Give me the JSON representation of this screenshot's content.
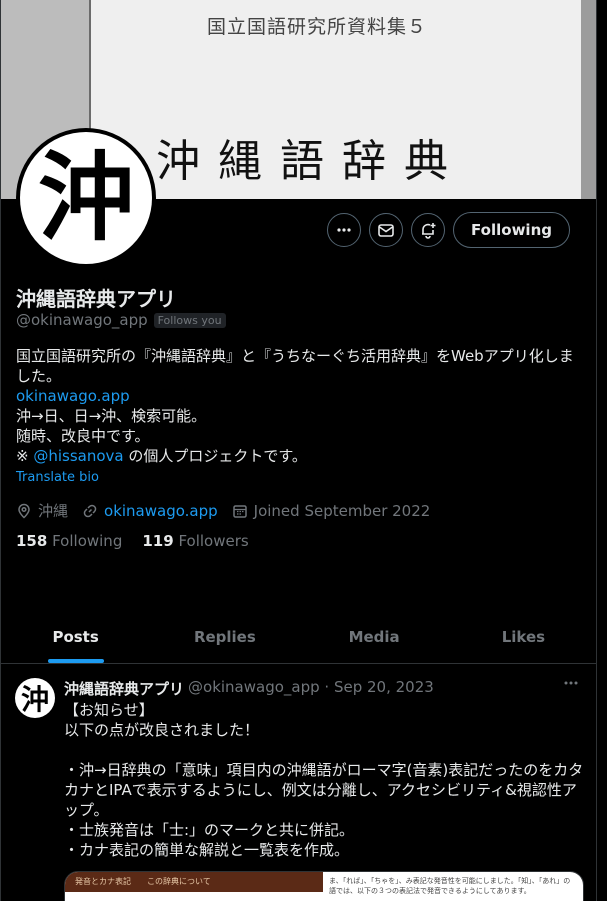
{
  "banner": {
    "subtitle": "国立国語研究所資料集５",
    "title": "沖縄語辞典"
  },
  "avatar": {
    "glyph": "沖"
  },
  "actions": {
    "following_label": "Following"
  },
  "profile": {
    "name": "沖縄語辞典アプリ",
    "handle": "@okinawago_app",
    "follows_you": "Follows you",
    "bio_line1": "国立国語研究所の『沖縄語辞典』と『うちなーぐち活用辞典』をWebアプリ化しました。",
    "bio_link": "okinawago.app",
    "bio_line3": "沖→日、日→沖、検索可能。",
    "bio_line4": "随時、改良中です。",
    "bio_prefix": "※ ",
    "bio_mention": "@hissanova",
    "bio_suffix": " の個人プロジェクトです。",
    "translate_bio": "Translate bio",
    "location": "沖縄",
    "website": "okinawago.app",
    "joined": "Joined September 2022",
    "following_count": "158",
    "following_label": "Following",
    "followers_count": "119",
    "followers_label": "Followers"
  },
  "tabs": [
    "Posts",
    "Replies",
    "Media",
    "Likes"
  ],
  "post": {
    "name": "沖縄語辞典アプリ",
    "meta": "@okinawago_app · Sep 20, 2023",
    "body": "【お知らせ】\n以下の点が改良されました！\n\n・沖→日辞典の「意味」項目内の沖縄語がローマ字(音素)表記だったのをカタカナとIPAで表示するようにし、例文は分離し、アクセシビリティ&視認性アップ。\n・士族発音は「士:」のマークと共に併記。\n・カナ表記の簡単な解説と一覧表を作成。",
    "media_header": "発音とカナ表記　　この辞典について",
    "media_text": "ま、「れば」、「ちゃを」、み表記な発音性を可能にしました。「知」、「あれ」の語では、以下の３つの表記法で発音できるようにしてあります。"
  },
  "colors": {
    "accent": "#1d9bf0",
    "muted": "#71767b",
    "bg": "#000000"
  }
}
